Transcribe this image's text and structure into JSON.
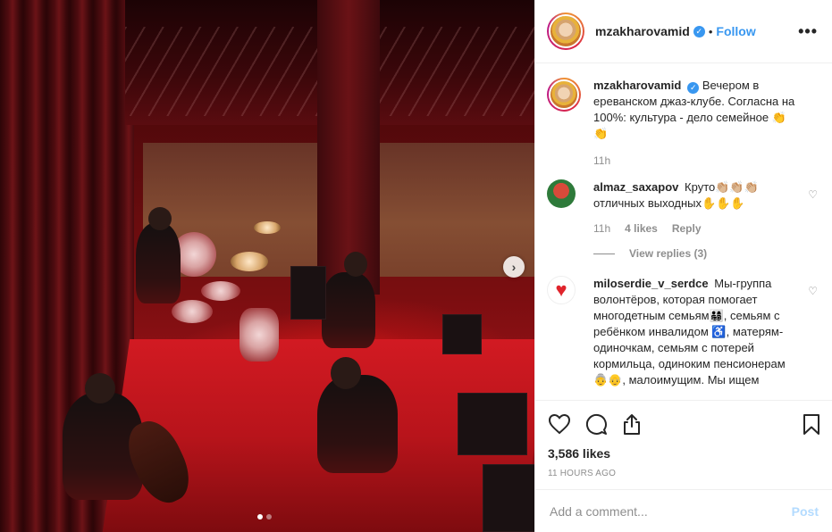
{
  "post": {
    "author": "mzakharovamid",
    "follow_label": "Follow",
    "separator": "•",
    "more_label": "•••",
    "caption": "Вечером в ереванском джаз-клубе. Согласна на 100%: культура - дело семейное 👏👏",
    "caption_time": "11h",
    "next_label": "›",
    "likes": "3,586 likes",
    "time_ago": "11 HOURS AGO"
  },
  "comments": [
    {
      "username": "almaz_saxapov",
      "text": "Круто👏🏼👏🏼👏🏼 отличных выходных✋✋✋",
      "time": "11h",
      "likes": "4 likes",
      "reply": "Reply",
      "view_replies": "View replies (3)"
    },
    {
      "username": "miloserdie_v_serdce",
      "text": "Мы-группа волонтёров, которая помогает многодетным семьям👨‍👩‍👧‍👦, семьям с ребёнком инвалидом ♿, матерям-одиночкам, семьям с потерей кормильца, одиноким пенсионерам👵👴, малоимущим. Мы ищем"
    }
  ],
  "add_comment": {
    "placeholder": "Add a comment...",
    "post_label": "Post"
  },
  "carousel": {
    "count": 2,
    "active": 1
  },
  "colors": {
    "accent": "#3897f0",
    "muted": "#8e8e8e",
    "post_disabled": "#b3dbff"
  },
  "icons": [
    "heart-icon",
    "comment-icon",
    "share-icon",
    "bookmark-icon",
    "verified-icon",
    "more-icon",
    "chevron-right-icon"
  ]
}
